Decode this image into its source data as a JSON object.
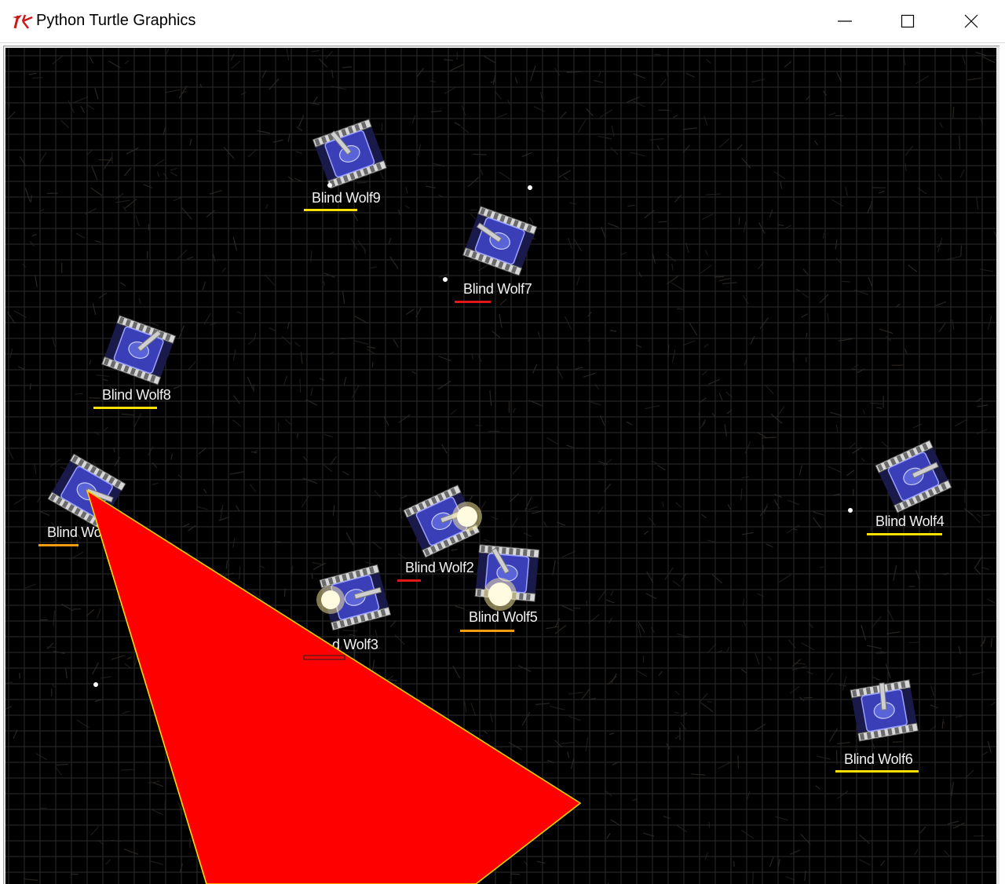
{
  "window": {
    "title": "Python Turtle Graphics",
    "icon": "tk-feather-icon",
    "controls": [
      "minimize-icon",
      "maximize-icon",
      "close-icon"
    ]
  },
  "colors": {
    "background": "#000000",
    "grid": "#2b2b2b",
    "vision_cone": "#ff0000",
    "vision_cone_edge": "#ffd400",
    "label": "#f2f2f2",
    "health_high": "#ffe000",
    "health_mid": "#f39c12",
    "health_low": "#e01818",
    "tank_body": "#3a3fb8",
    "tread": "#d8d8d8"
  },
  "tanks": [
    {
      "name": "Blind Wolf9",
      "health_color": "health_high"
    },
    {
      "name": "Blind Wolf7",
      "health_color": "health_low"
    },
    {
      "name": "Blind Wolf8",
      "health_color": "health_high"
    },
    {
      "name": "Blind Wo",
      "health_color": "health_mid"
    },
    {
      "name": "Blind Wolf2",
      "health_color": "health_low"
    },
    {
      "name": "Blind Wolf5",
      "health_color": "health_mid"
    },
    {
      "name": "d Wolf3",
      "health_color": "health_none"
    },
    {
      "name": "Blind Wolf4",
      "health_color": "health_high"
    },
    {
      "name": "Blind Wolf6",
      "health_color": "health_high"
    }
  ]
}
